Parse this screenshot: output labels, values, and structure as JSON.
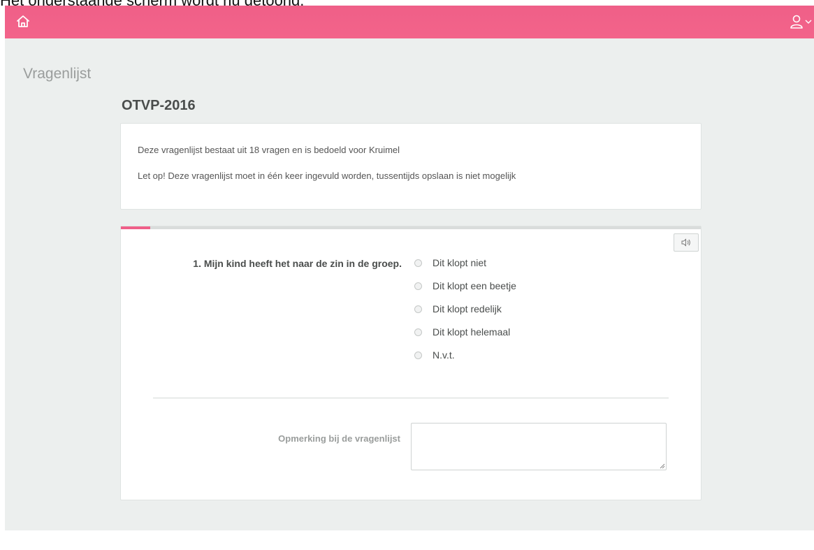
{
  "caption": "Het onderstaande scherm wordt nu getoond.",
  "colors": {
    "brand": "#ef5f88",
    "background": "#ecefee",
    "card": "#ffffff"
  },
  "header": {
    "home_icon": "home-icon",
    "user_icon": "user-icon",
    "user_menu_chevron": "chevron-down-icon"
  },
  "page": {
    "heading": "Vragenlijst",
    "form_title": "OTVP-2016"
  },
  "intro": {
    "line1": "Deze vragenlijst bestaat uit 18 vragen en is bedoeld voor Kruimel",
    "line2": "Let op! Deze vragenlijst moet in één keer ingevuld worden, tussentijds opslaan is niet mogelijk"
  },
  "progress": {
    "current_question": 1,
    "total_questions": 18,
    "fraction": 0.05
  },
  "question": {
    "audio_icon": "speaker-icon",
    "label": "1. Mijn kind heeft het naar de zin in de groep.",
    "options": [
      "Dit klopt niet",
      "Dit klopt een beetje",
      "Dit klopt redelijk",
      "Dit klopt helemaal",
      "N.v.t."
    ]
  },
  "remark": {
    "label": "Opmerking bij de vragenlijst",
    "value": ""
  }
}
